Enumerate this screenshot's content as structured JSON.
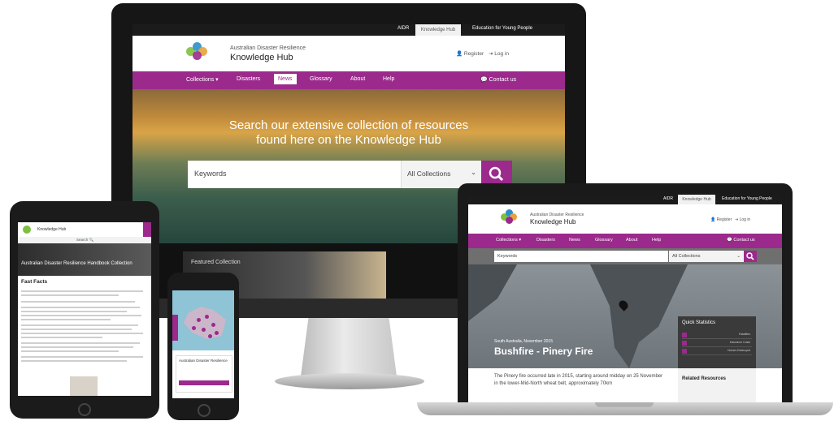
{
  "desktop": {
    "topbar": {
      "aidr": "AIDR",
      "tab_hub": "Knowledge Hub",
      "tab_young": "Education for Young People"
    },
    "header": {
      "org_name": "Australian Disaster Resilience",
      "hub_name": "Knowledge Hub",
      "register": "Register",
      "login": "Log in"
    },
    "nav": [
      "Collections ▾",
      "Disasters",
      "News",
      "Glossary",
      "About",
      "Help"
    ],
    "contact": "Contact us",
    "hero": {
      "line1": "Search our extensive collection of resources",
      "line2": "found here on the Knowledge Hub"
    },
    "search": {
      "keywords": "Keywords",
      "collections": "All Collections"
    },
    "lower_text": "Featured Collection"
  },
  "tablet": {
    "hub": "Knowledge Hub",
    "search": "Search 🔍",
    "hero_title": "Australian Disaster Resilience Handbook Collection",
    "facts_heading": "Fast Facts"
  },
  "phone": {
    "card_title": "Australian Disaster Resilience"
  },
  "laptop": {
    "topbar": {
      "aidr": "AIDR",
      "tab_hub": "Knowledge Hub",
      "tab_young": "Education for Young People"
    },
    "header": {
      "org_name": "Australian Disaster Resilience",
      "hub_name": "Knowledge Hub",
      "register": "Register",
      "login": "Log in"
    },
    "nav": [
      "Collections ▾",
      "Disasters",
      "News",
      "Glossary",
      "About",
      "Help"
    ],
    "contact": "Contact us",
    "search": {
      "keywords": "Keywords",
      "collections": "All Collections"
    },
    "event": {
      "subtitle": "South Australia, November 2015",
      "title": "Bushfire - Pinery Fire"
    },
    "quick_stats": {
      "title": "Quick Statistics",
      "rows": [
        "Fatalities",
        "Insurance Costs",
        "Homes Destroyed"
      ]
    },
    "body_text": "The Pinery fire occurred late in 2015, starting around midday on 25 November in the lower-Mid-North wheat belt, approximately 70km",
    "related": "Related Resources"
  },
  "colors": {
    "brand_purple": "#9b2a8c"
  }
}
